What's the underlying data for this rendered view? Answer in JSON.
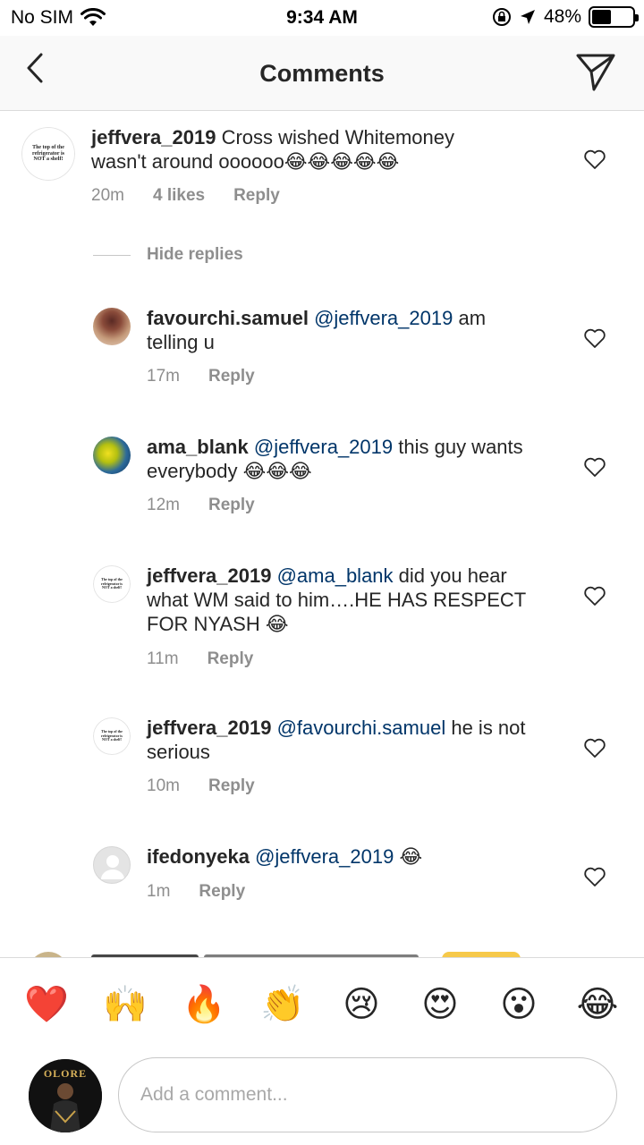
{
  "status_bar": {
    "carrier": "No SIM",
    "time": "9:34 AM",
    "battery_text": "48%",
    "battery_level": 0.48
  },
  "nav": {
    "title": "Comments",
    "back_icon": "chevron-left-icon",
    "send_icon": "paper-plane-icon"
  },
  "avatar_caption": "The top of the refrigerator is NOT a shelf!",
  "main_comment": {
    "username": "jeffvera_2019",
    "text": "Cross wished Whitemoney wasn't around oooooo",
    "emojis": "😂😂😂😂😂",
    "time": "20m",
    "likes": "4 likes",
    "reply": "Reply"
  },
  "hide_replies": "Hide replies",
  "replies": [
    {
      "username": "favourchi.samuel",
      "mention": "@jeffvera_2019",
      "text": "am telling u",
      "emojis": "",
      "time": "17m",
      "reply": "Reply"
    },
    {
      "username": "ama_blank",
      "mention": "@jeffvera_2019",
      "text": "this guy wants everybody",
      "emojis": "😂😂😂",
      "time": "12m",
      "reply": "Reply"
    },
    {
      "username": "jeffvera_2019",
      "mention": "@ama_blank",
      "text": "did you hear what WM said to him….HE HAS RESPECT FOR NYASH",
      "emojis": "😂",
      "time": "11m",
      "reply": "Reply"
    },
    {
      "username": "jeffvera_2019",
      "mention": "@favourchi.samuel",
      "text": "he is not serious",
      "emojis": "",
      "time": "10m",
      "reply": "Reply"
    },
    {
      "username": "ifedonyeka",
      "mention": "@jeffvera_2019",
      "text": "",
      "emojis": "😂",
      "time": "1m",
      "reply": "Reply"
    }
  ],
  "emoji_bar": [
    "❤️",
    "🙌",
    "🔥",
    "👏",
    "😢",
    "😍",
    "😮",
    "😂"
  ],
  "input": {
    "placeholder": "Add a comment...",
    "avatar_label": "OLORE"
  },
  "colors": {
    "mention": "#003569",
    "muted": "#8e8e8e",
    "text": "#262626"
  }
}
